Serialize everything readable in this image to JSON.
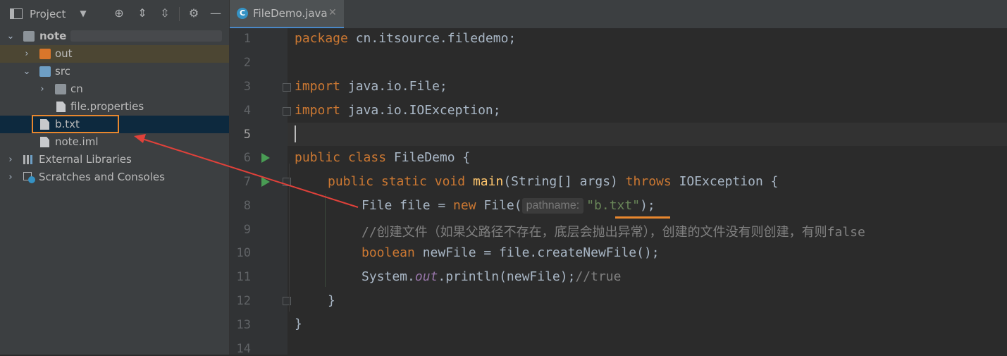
{
  "project_panel": {
    "title": "Project",
    "tree": [
      {
        "label": "note",
        "type": "module"
      },
      {
        "label": "out",
        "type": "folder"
      },
      {
        "label": "src",
        "type": "folder"
      },
      {
        "label": "cn",
        "type": "package"
      },
      {
        "label": "file.properties",
        "type": "file"
      },
      {
        "label": "b.txt",
        "type": "file"
      },
      {
        "label": "note.iml",
        "type": "file"
      },
      {
        "label": "External Libraries",
        "type": "libraries"
      },
      {
        "label": "Scratches and Consoles",
        "type": "scratches"
      }
    ]
  },
  "editor": {
    "tab_label": "FileDemo.java",
    "line_numbers": [
      "1",
      "2",
      "3",
      "4",
      "5",
      "6",
      "7",
      "8",
      "9",
      "10",
      "11",
      "12",
      "13",
      "14"
    ],
    "current_line": 5,
    "code": {
      "l1_kw": "package",
      "l1_rest": " cn.itsource.filedemo;",
      "l3_kw": "import",
      "l3_rest": " java.io.File;",
      "l4_kw": "import",
      "l4_rest": " java.io.IOException;",
      "l6_kw1": "public",
      "l6_kw2": "class",
      "l6_rest": " FileDemo {",
      "l7_kw1": "public",
      "l7_kw2": "static",
      "l7_kw3": "void",
      "l7_fn": "main",
      "l7_mid": "(String[] args) ",
      "l7_kw4": "throws",
      "l7_rest": " IOException {",
      "l8_a": "File file = ",
      "l8_kw": "new",
      "l8_b": " File(",
      "l8_hint": "pathname:",
      "l8_str": "\"b.txt\"",
      "l8_c": ");",
      "l9_comment": "//创建文件（如果父路径不存在，底层会抛出异常），创建的文件没有则创建，有则false",
      "l10_kw": "boolean",
      "l10_rest": " newFile = file.createNewFile();",
      "l11_a": "System.",
      "l11_static": "out",
      "l11_b": ".println(newFile);",
      "l11_comment": "//true",
      "l12": "}",
      "l13": "}"
    }
  },
  "colors": {
    "keyword": "#cc7832",
    "string": "#6a8759",
    "comment": "#808080",
    "function": "#ffc66d",
    "annotation_highlight": "#e8872e",
    "arrow": "#e0413a"
  }
}
